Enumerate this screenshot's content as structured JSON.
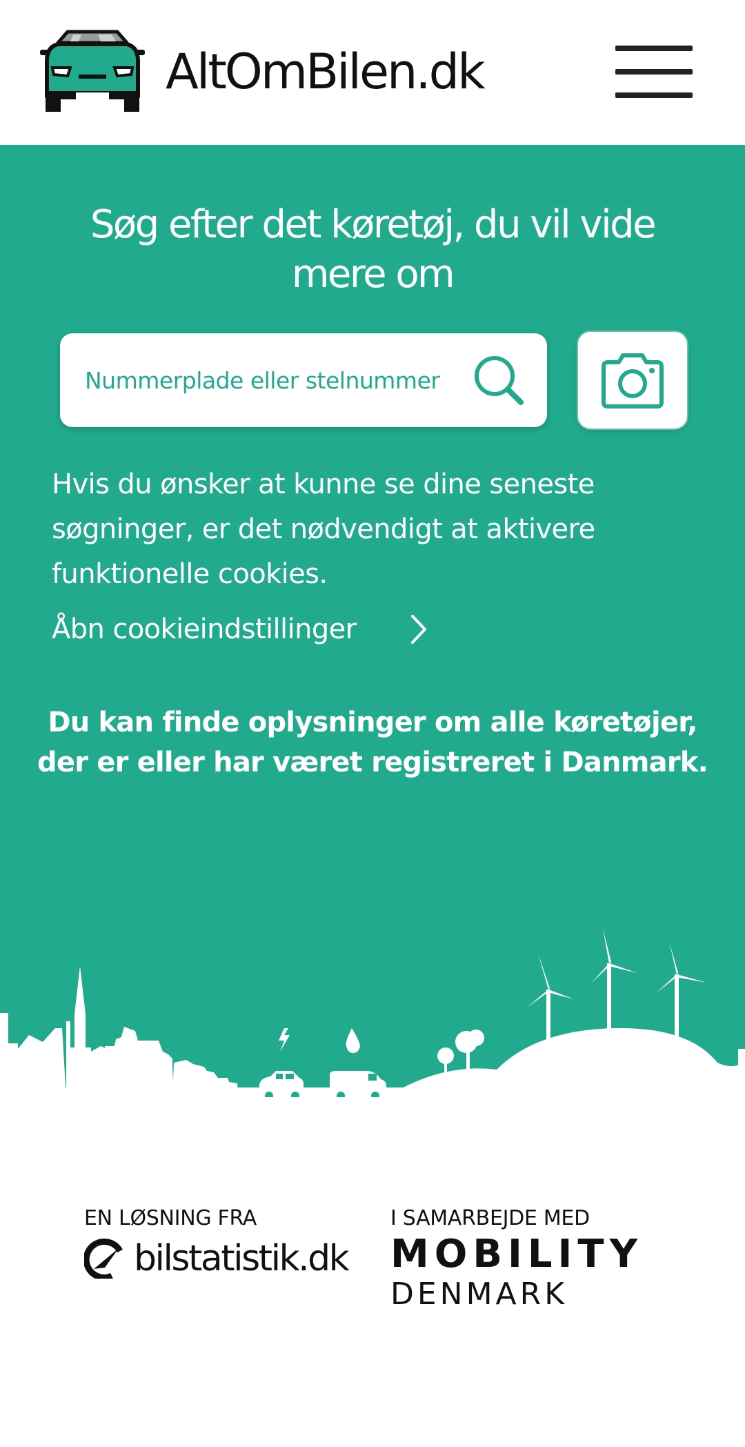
{
  "header": {
    "logo_text": "AltOmBilen.dk",
    "logo_icon": "car-front-icon",
    "menu_icon": "hamburger-menu-icon"
  },
  "hero": {
    "title": "Søg efter det køretøj, du vil vide mere om",
    "search": {
      "placeholder": "Nummerplade eller stelnummer",
      "value": "",
      "icon": "search-icon"
    },
    "camera_icon": "camera-icon",
    "cookie_notice": "Hvis du ønsker at kunne se dine seneste søgninger, er det nødvendigt at aktivere funktionelle cookies.",
    "cookie_link": "Åbn cookieindstillinger",
    "info": "Du kan finde oplysninger om alle køretøjer, der er eller har været registreret i Danmark.",
    "skyline_image": "city-skyline-illustration"
  },
  "footer": {
    "left_label": "EN LØSNING FRA",
    "left_partner": "bilstatistik.dk",
    "right_label": "I SAMARBEJDE MED",
    "right_partner_top": "MOBILITY",
    "right_partner_bottom": "DENMARK"
  },
  "colors": {
    "brand_green": "#21aa8d",
    "text_dark": "#111111",
    "white": "#ffffff"
  }
}
